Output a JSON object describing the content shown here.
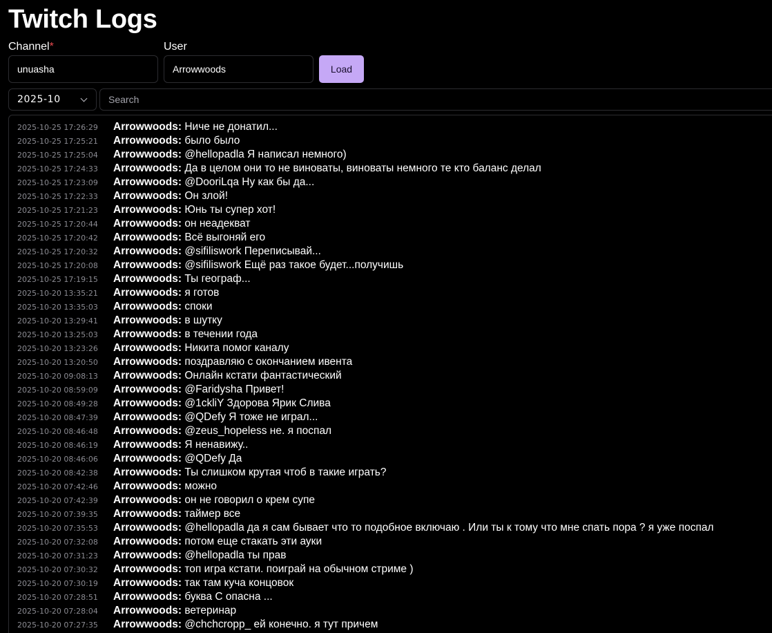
{
  "app": {
    "title": "Twitch Logs"
  },
  "form": {
    "channel_label": "Channel",
    "channel_required_mark": "*",
    "channel_value": "unuasha",
    "user_label": "User",
    "user_value": "Arrowwoods",
    "load_label": "Load"
  },
  "filters": {
    "month_value": "2025-10",
    "search_placeholder": "Search"
  },
  "colors": {
    "background": "#000000",
    "accent": "#c5a8f6",
    "border": "#2c2c30",
    "timestamp": "#8b8b92",
    "required": "#e5484d"
  },
  "icons": {
    "month_select": "chevron-down-icon"
  },
  "log": {
    "messages": [
      {
        "time": "2025-10-25 17:26:29",
        "user": "Arrowwoods:",
        "text": "Ниче не донатил..."
      },
      {
        "time": "2025-10-25 17:25:21",
        "user": "Arrowwoods:",
        "text": "было было"
      },
      {
        "time": "2025-10-25 17:25:04",
        "user": "Arrowwoods:",
        "text": "@hellopadla Я написал немного)"
      },
      {
        "time": "2025-10-25 17:24:33",
        "user": "Arrowwoods:",
        "text": "Да в целом они то не виноваты, виноваты немного те кто баланс делал"
      },
      {
        "time": "2025-10-25 17:23:09",
        "user": "Arrowwoods:",
        "text": "@DooriLqa Ну как бы да..."
      },
      {
        "time": "2025-10-25 17:22:33",
        "user": "Arrowwoods:",
        "text": "Он злой!"
      },
      {
        "time": "2025-10-25 17:21:23",
        "user": "Arrowwoods:",
        "text": "Юнь ты супер хот!"
      },
      {
        "time": "2025-10-25 17:20:44",
        "user": "Arrowwoods:",
        "text": "он неадекват"
      },
      {
        "time": "2025-10-25 17:20:42",
        "user": "Arrowwoods:",
        "text": "Всё выгоняй его"
      },
      {
        "time": "2025-10-25 17:20:32",
        "user": "Arrowwoods:",
        "text": "@sifiliswork Переписывай..."
      },
      {
        "time": "2025-10-25 17:20:08",
        "user": "Arrowwoods:",
        "text": "@sifiliswork Ещё раз такое будет...получишь"
      },
      {
        "time": "2025-10-25 17:19:15",
        "user": "Arrowwoods:",
        "text": "Ты географ..."
      },
      {
        "time": "2025-10-20 13:35:21",
        "user": "Arrowwoods:",
        "text": "я готов"
      },
      {
        "time": "2025-10-20 13:35:03",
        "user": "Arrowwoods:",
        "text": "споки"
      },
      {
        "time": "2025-10-20 13:29:41",
        "user": "Arrowwoods:",
        "text": "в шутку"
      },
      {
        "time": "2025-10-20 13:25:03",
        "user": "Arrowwoods:",
        "text": "в течении года"
      },
      {
        "time": "2025-10-20 13:23:26",
        "user": "Arrowwoods:",
        "text": "Никита помог каналу"
      },
      {
        "time": "2025-10-20 13:20:50",
        "user": "Arrowwoods:",
        "text": "поздравляю с окончанием ивента"
      },
      {
        "time": "2025-10-20 09:08:13",
        "user": "Arrowwoods:",
        "text": "Онлайн кстати фантастический"
      },
      {
        "time": "2025-10-20 08:59:09",
        "user": "Arrowwoods:",
        "text": "@Faridysha Привет!"
      },
      {
        "time": "2025-10-20 08:49:28",
        "user": "Arrowwoods:",
        "text": "@1ckliY Здорова Ярик Слива"
      },
      {
        "time": "2025-10-20 08:47:39",
        "user": "Arrowwoods:",
        "text": "@QDefy Я тоже не играл..."
      },
      {
        "time": "2025-10-20 08:46:48",
        "user": "Arrowwoods:",
        "text": "@zeus_hopeless не. я поспал"
      },
      {
        "time": "2025-10-20 08:46:19",
        "user": "Arrowwoods:",
        "text": "Я ненавижу.."
      },
      {
        "time": "2025-10-20 08:46:06",
        "user": "Arrowwoods:",
        "text": "@QDefy Да"
      },
      {
        "time": "2025-10-20 08:42:38",
        "user": "Arrowwoods:",
        "text": "Ты слишком крутая чтоб в такие играть?"
      },
      {
        "time": "2025-10-20 07:42:46",
        "user": "Arrowwoods:",
        "text": "можно"
      },
      {
        "time": "2025-10-20 07:42:39",
        "user": "Arrowwoods:",
        "text": "он не говорил о крем супе"
      },
      {
        "time": "2025-10-20 07:39:35",
        "user": "Arrowwoods:",
        "text": "таймер все"
      },
      {
        "time": "2025-10-20 07:35:53",
        "user": "Arrowwoods:",
        "text": "@hellopadla да я сам бывает что то подобное включаю . Или ты к тому что мне спать пора ? я уже поспал"
      },
      {
        "time": "2025-10-20 07:32:08",
        "user": "Arrowwoods:",
        "text": "потом еще стакать эти ауки"
      },
      {
        "time": "2025-10-20 07:31:23",
        "user": "Arrowwoods:",
        "text": "@hellopadla ты прав"
      },
      {
        "time": "2025-10-20 07:30:32",
        "user": "Arrowwoods:",
        "text": "топ игра кстати. поиграй на обычном стриме )"
      },
      {
        "time": "2025-10-20 07:30:19",
        "user": "Arrowwoods:",
        "text": "так там куча концовок"
      },
      {
        "time": "2025-10-20 07:28:51",
        "user": "Arrowwoods:",
        "text": "буква С опасна ..."
      },
      {
        "time": "2025-10-20 07:28:04",
        "user": "Arrowwoods:",
        "text": "ветеринар"
      },
      {
        "time": "2025-10-20 07:27:35",
        "user": "Arrowwoods:",
        "text": "@chchcropp_ ей конечно. я тут причем"
      }
    ]
  }
}
